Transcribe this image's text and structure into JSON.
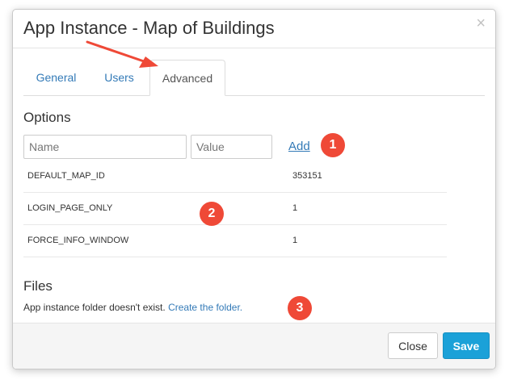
{
  "dialog": {
    "title": "App Instance - Map of Buildings",
    "close_glyph": "×"
  },
  "tabs": [
    {
      "label": "General",
      "active": false
    },
    {
      "label": "Users",
      "active": false
    },
    {
      "label": "Advanced",
      "active": true
    }
  ],
  "options": {
    "title": "Options",
    "name_placeholder": "Name",
    "value_placeholder": "Value",
    "add_label": "Add",
    "rows": [
      {
        "key": "DEFAULT_MAP_ID",
        "value": "353151"
      },
      {
        "key": "LOGIN_PAGE_ONLY",
        "value": "1"
      },
      {
        "key": "FORCE_INFO_WINDOW",
        "value": "1"
      }
    ]
  },
  "files": {
    "title": "Files",
    "message": "App instance folder doesn't exist.",
    "link": "Create the folder."
  },
  "footer": {
    "close_label": "Close",
    "save_label": "Save"
  },
  "annotations": {
    "badges": [
      "1",
      "2",
      "3"
    ],
    "badge_color": "#ef4937",
    "arrow_color": "#ef4937"
  },
  "colors": {
    "link": "#337ab7",
    "primary_button": "#1ba1d8"
  }
}
